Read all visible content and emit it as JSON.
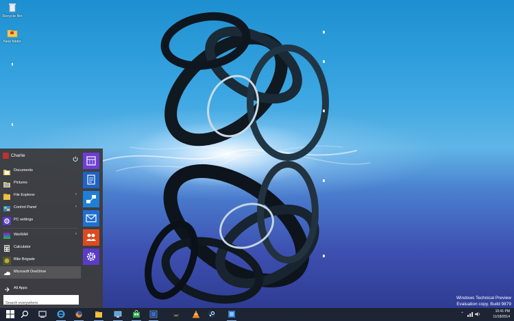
{
  "desktop": {
    "icons": [
      {
        "label": "Recycle Bin",
        "icon": "recycle-bin-icon"
      },
      {
        "label": "New folder",
        "icon": "folder-icon"
      }
    ],
    "watermark": {
      "line1": "Windows Technical Preview",
      "line2": "Evaluation copy. Build 9879"
    }
  },
  "start_menu": {
    "user_name": "Charlie",
    "items": [
      {
        "label": "Documents",
        "icon": "documents-folder-icon",
        "has_submenu": false
      },
      {
        "label": "Pictures",
        "icon": "pictures-folder-icon",
        "has_submenu": false
      },
      {
        "label": "File Explorer",
        "icon": "file-explorer-icon",
        "has_submenu": true
      },
      {
        "label": "Control Panel",
        "icon": "control-panel-icon",
        "has_submenu": true
      },
      {
        "label": "PC settings",
        "icon": "gear-icon",
        "has_submenu": false
      },
      {
        "label": "WinRAR",
        "icon": "winrar-icon",
        "has_submenu": true
      },
      {
        "label": "Calculator",
        "icon": "calculator-icon",
        "has_submenu": false
      },
      {
        "label": "Blitz Brigade",
        "icon": "blitz-brigade-icon",
        "has_submenu": false
      },
      {
        "label": "Microsoft OneDrive",
        "icon": "onedrive-icon",
        "has_submenu": false,
        "highlighted": true
      }
    ],
    "all_apps_label": "All Apps",
    "search_placeholder": "Search everywhere",
    "tiles": [
      {
        "icon": "calendar-icon",
        "color": "#6b3fd2"
      },
      {
        "icon": "reader-icon",
        "color": "#1f63c4"
      },
      {
        "icon": "network-icon",
        "color": "#1f7fd6"
      },
      {
        "icon": "mail-icon",
        "color": "#1f70d0"
      },
      {
        "icon": "people-icon",
        "color": "#de4a1f"
      },
      {
        "icon": "settings-icon",
        "color": "#5a3cc8"
      }
    ]
  },
  "taskbar": {
    "buttons": [
      {
        "icon": "windows-start-icon"
      },
      {
        "icon": "search-icon"
      },
      {
        "icon": "task-view-icon"
      },
      {
        "icon": "internet-explorer-icon"
      },
      {
        "icon": "firefox-icon"
      },
      {
        "icon": "file-explorer-icon"
      },
      {
        "icon": "remote-desktop-icon"
      },
      {
        "icon": "store-icon"
      },
      {
        "icon": "virtualbox-icon"
      },
      {
        "icon": "cat-app-icon"
      },
      {
        "icon": "vlc-icon"
      },
      {
        "icon": "steam-icon"
      },
      {
        "icon": "blue-app-icon"
      }
    ],
    "clock_time": "10:41 PM",
    "clock_date": "11/18/2014",
    "accent": "#1d2433"
  }
}
